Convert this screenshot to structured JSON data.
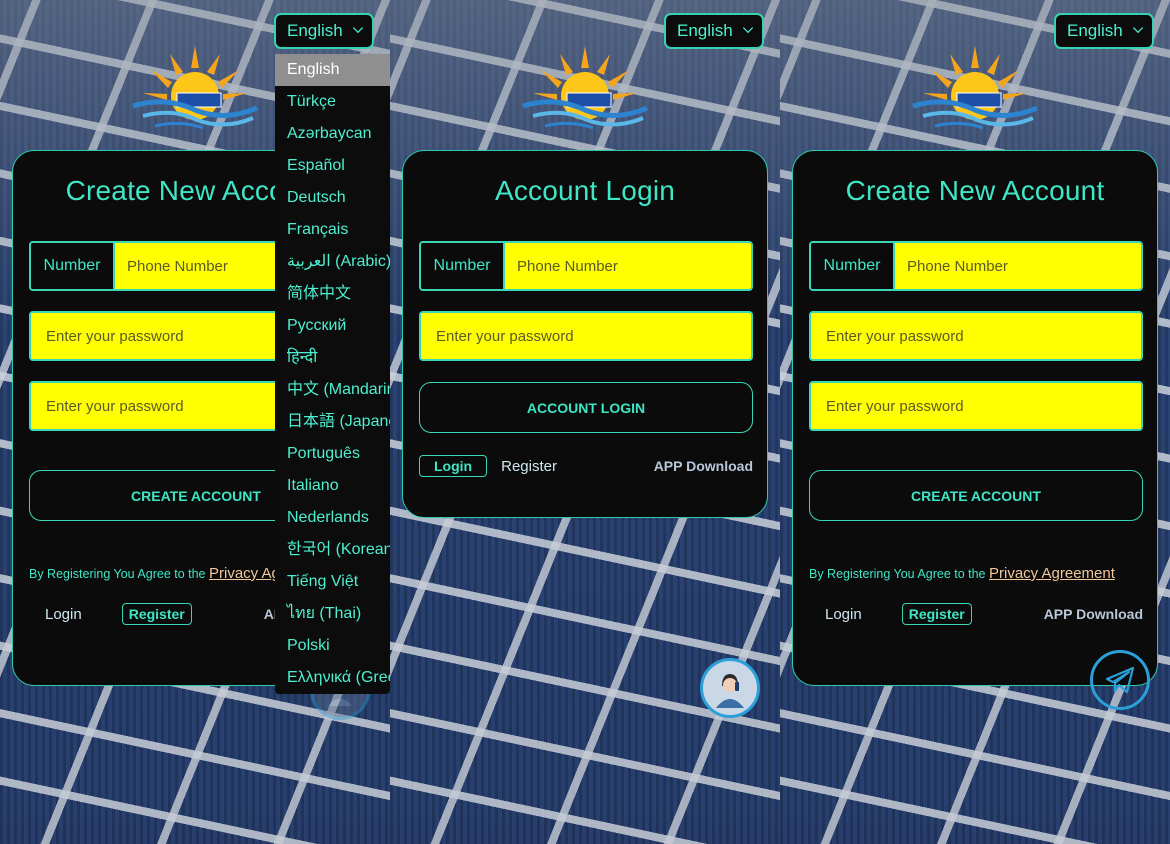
{
  "language": {
    "selected": "English",
    "options": [
      "English",
      "Türkçe",
      "Azərbaycan",
      "Español",
      "Deutsch",
      "Français",
      "العربية (Arabic)",
      "简体中文",
      "Русский",
      "हिन्दी",
      "中文 (Mandarin)",
      "日本語 (Japanese)",
      "Português",
      "Italiano",
      "Nederlands",
      "한국어 (Korean)",
      "Tiếng Việt",
      "ไทย (Thai)",
      "Polski",
      "Ελληνικά (Greek)"
    ]
  },
  "register": {
    "title": "Create New Account",
    "number_label": "Number",
    "phone_placeholder": "Phone Number",
    "password_placeholder": "Enter your password",
    "confirm_placeholder": "Enter your password",
    "create_button": "CREATE ACCOUNT",
    "agree_text": "By Registering You Agree to the ",
    "privacy_link": "Privacy Agreement",
    "login_link": "Login",
    "register_tab": "Register",
    "app_download": "APP Download"
  },
  "login": {
    "title": "Account Login",
    "number_label": "Number",
    "phone_placeholder": "Phone Number",
    "password_placeholder": "Enter your password",
    "login_button": "ACCOUNT LOGIN",
    "login_tab": "Login",
    "register_link": "Register",
    "app_download": "APP Download"
  },
  "colors": {
    "accent": "#3fe6c6",
    "input_bg": "#ffff00",
    "card_bg": "#0b0b0b",
    "link": "#f2c79b"
  }
}
